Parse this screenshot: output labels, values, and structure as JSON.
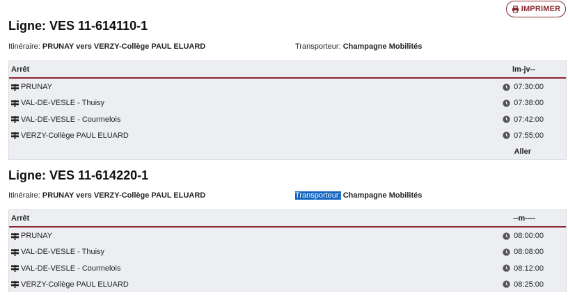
{
  "print_button": {
    "label": "IMPRIMER",
    "icon": "printer-icon",
    "color": "#8a2630"
  },
  "accent_color": "#8a2630",
  "lines": [
    {
      "title": "Ligne: VES 11-614110-1",
      "itinerary_label": "Itinéraire:",
      "itinerary_value": "PRUNAY vers VERZY-Collège PAUL ELUARD",
      "carrier_label": "Transporteur:",
      "carrier_value": "Champagne Mobilités",
      "carrier_label_selected": false,
      "table": {
        "col_stop": "Arrêt",
        "col_days": "lm-jv--",
        "rows": [
          {
            "stop": "PRUNAY",
            "time": "07:30:00"
          },
          {
            "stop": "VAL-DE-VESLE - Thuisy",
            "time": "07:38:00"
          },
          {
            "stop": "VAL-DE-VESLE - Courmelois",
            "time": "07:42:00"
          },
          {
            "stop": "VERZY-Collège PAUL ELUARD",
            "time": "07:55:00"
          }
        ],
        "footer": "Aller"
      }
    },
    {
      "title": "Ligne: VES 11-614220-1",
      "itinerary_label": "Itinéraire:",
      "itinerary_value": "PRUNAY vers VERZY-Collège PAUL ELUARD",
      "carrier_label": "Transporteur:",
      "carrier_value": "Champagne Mobilités",
      "carrier_label_selected": true,
      "table": {
        "col_stop": "Arrêt",
        "col_days": "--m----",
        "rows": [
          {
            "stop": "PRUNAY",
            "time": "08:00:00"
          },
          {
            "stop": "VAL-DE-VESLE - Thuisy",
            "time": "08:08:00"
          },
          {
            "stop": "VAL-DE-VESLE - Courmelois",
            "time": "08:12:00"
          },
          {
            "stop": "VERZY-Collège PAUL ELUARD",
            "time": "08:25:00"
          }
        ]
      }
    }
  ]
}
